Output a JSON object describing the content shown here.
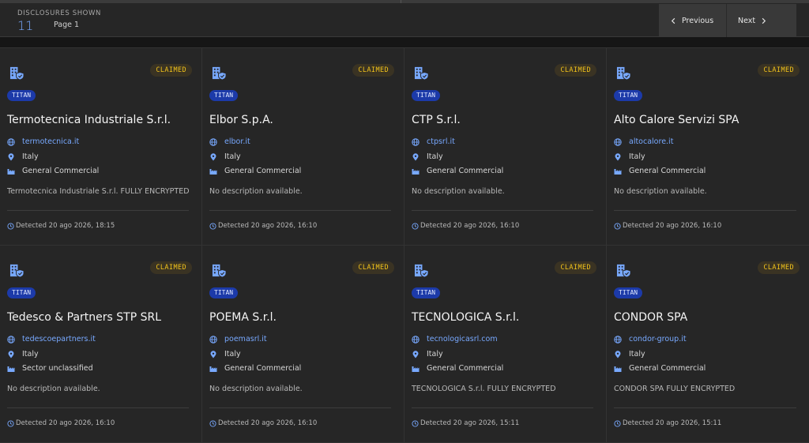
{
  "header": {
    "disclosures_label": "DISCLOSURES SHOWN",
    "count": "11",
    "page": "Page 1",
    "previous": "Previous",
    "next": "Next"
  },
  "colors": {
    "accent": "#78a9ff",
    "claimed": "#f1c21b",
    "tag_bg": "#1c3aa9"
  },
  "cards": [
    {
      "status": "CLAIMED",
      "group": "TITAN",
      "name": "Termotecnica Industriale S.r.l.",
      "website": "termotecnica.it",
      "country": "Italy",
      "sector": "General Commercial",
      "description": "Termotecnica Industriale S.r.l. FULLY ENCRYPTED",
      "detected": "Detected 20 ago 2026, 18:15"
    },
    {
      "status": "CLAIMED",
      "group": "TITAN",
      "name": "Elbor S.p.A.",
      "website": "elbor.it",
      "country": "Italy",
      "sector": "General Commercial",
      "description": "No description available.",
      "detected": "Detected 20 ago 2026, 16:10"
    },
    {
      "status": "CLAIMED",
      "group": "TITAN",
      "name": "CTP S.r.l.",
      "website": "ctpsrl.it",
      "country": "Italy",
      "sector": "General Commercial",
      "description": "No description available.",
      "detected": "Detected 20 ago 2026, 16:10"
    },
    {
      "status": "CLAIMED",
      "group": "TITAN",
      "name": "Alto Calore Servizi SPA",
      "website": "altocalore.it",
      "country": "Italy",
      "sector": "General Commercial",
      "description": "No description available.",
      "detected": "Detected 20 ago 2026, 16:10"
    },
    {
      "status": "CLAIMED",
      "group": "TITAN",
      "name": "Tedesco & Partners STP SRL",
      "website": "tedescoepartners.it",
      "country": "Italy",
      "sector": "Sector unclassified",
      "description": "No description available.",
      "detected": "Detected 20 ago 2026, 16:10"
    },
    {
      "status": "CLAIMED",
      "group": "TITAN",
      "name": "POEMA S.r.l.",
      "website": "poemasrl.it",
      "country": "Italy",
      "sector": "General Commercial",
      "description": "No description available.",
      "detected": "Detected 20 ago 2026, 16:10"
    },
    {
      "status": "CLAIMED",
      "group": "TITAN",
      "name": "TECNOLOGICA S.r.l.",
      "website": "tecnologicasrl.com",
      "country": "Italy",
      "sector": "General Commercial",
      "description": "TECNOLOGICA S.r.l. FULLY ENCRYPTED",
      "detected": "Detected 20 ago 2026, 15:11"
    },
    {
      "status": "CLAIMED",
      "group": "TITAN",
      "name": "CONDOR SPA",
      "website": "condor-group.it",
      "country": "Italy",
      "sector": "General Commercial",
      "description": "CONDOR SPA FULLY ENCRYPTED",
      "detected": "Detected 20 ago 2026, 15:11"
    }
  ]
}
